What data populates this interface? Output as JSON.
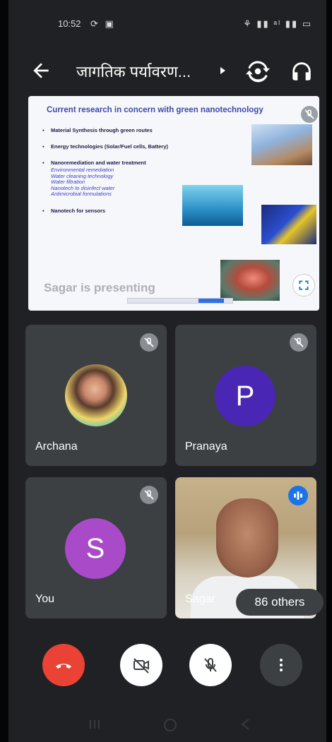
{
  "status_bar": {
    "time": "10:52",
    "left_icons": "⟳ ▣",
    "right_icons": "⚘ ▮▮ ᵃˡ ▮▮ ▭"
  },
  "top_bar": {
    "meeting_title": "जागतिक पर्यावरण..."
  },
  "presentation": {
    "slide_title": "Current research in concern with green nanotechnology",
    "bullets": [
      "Material Synthesis through green routes",
      "Energy technologies (Solar/Fuel cells, Battery)",
      "Nanoremediation and water treatment",
      "Nanotech for sensors"
    ],
    "sub_bullets": [
      "Environmental remediation",
      "Water cleaning technology",
      "Water filtration",
      "Nanotech to disinfect water",
      "Antimicrobial formulations"
    ],
    "presenting_label": "Sagar is presenting"
  },
  "participants": [
    {
      "name": "Archana",
      "muted": true,
      "avatar": "photo"
    },
    {
      "name": "Pranaya",
      "muted": true,
      "avatar_letter": "P",
      "avatar_color": "#4a26b5"
    },
    {
      "name": "You",
      "muted": true,
      "avatar_letter": "S",
      "avatar_color": "#a94bc9"
    },
    {
      "name": "Sagar",
      "speaking": true,
      "avatar": "video"
    }
  ],
  "others_chip": "86 others",
  "colors": {
    "end_call": "#ea4335",
    "speaking_indicator": "#1a73e8",
    "tile_bg": "#3c4043",
    "app_bg": "#202124"
  },
  "icons": {
    "back": "arrow-left-icon",
    "switch_camera": "switch-camera-icon",
    "audio_output": "headphones-icon",
    "end_call": "phone-hangup-icon",
    "camera": "camera-off-icon",
    "mic": "mic-off-icon",
    "more": "more-vertical-icon"
  }
}
